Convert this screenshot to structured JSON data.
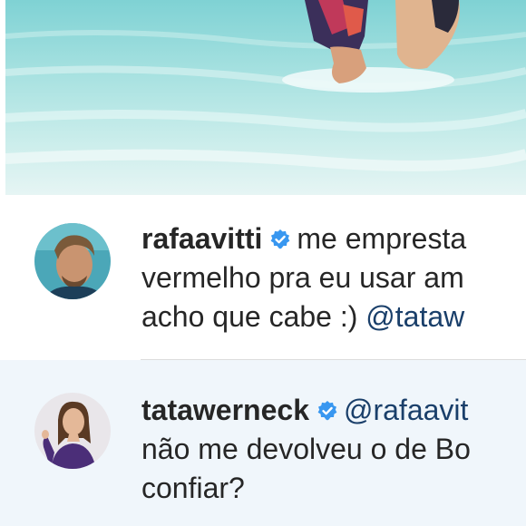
{
  "post": {
    "image": "beach-photo"
  },
  "comments": [
    {
      "avatar": "avatar-rafaavitti",
      "username": "rafaavitti",
      "verified_icon": "verified-badge-icon",
      "line1_text": "me empresta",
      "line2": "vermelho pra eu usar am",
      "line3_text": "acho que cabe :) ",
      "line3_mention": "@tataw"
    },
    {
      "avatar": "avatar-tatawerneck",
      "username": "tatawerneck",
      "verified_icon": "verified-badge-icon",
      "line1_mention": "@rafaavit",
      "line2": "não me devolveu o de Bo",
      "line3": "confiar?"
    }
  ],
  "colors": {
    "text": "#262626",
    "mention": "#1a3f6a",
    "verified": "#3897f0",
    "highlight_row": "#f0f6fb"
  }
}
